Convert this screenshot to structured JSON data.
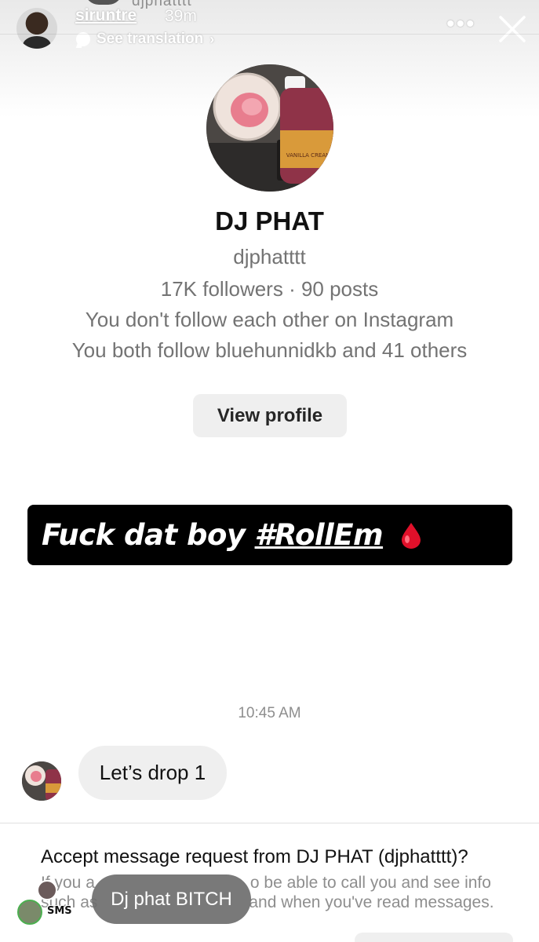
{
  "story_header": {
    "ghost_name": "djphatttt",
    "username": "siruntre",
    "time_ago": "39m",
    "translation_label": "See translation",
    "icons": [
      "speech-bubble-icon",
      "chevron-right-icon",
      "more-icon",
      "close-icon"
    ]
  },
  "profile": {
    "name": "DJ PHAT",
    "handle": "djphatttt",
    "stats": "17K followers · 90 posts",
    "follow_status": "You don't follow each other on Instagram",
    "mutual": "You both follow bluehunnidkb and 41 others",
    "view_profile_label": "View profile",
    "bottle_label": "VANILLA CREAM"
  },
  "story_caption": {
    "text": "Fuck dat boy",
    "hashtag": "#RollEm",
    "emoji": "drop-of-blood-icon"
  },
  "chat": {
    "timestamp": "10:45 AM",
    "message": "Let’s drop 1"
  },
  "message_request": {
    "title": "Accept message request from DJ PHAT (djphatttt)?",
    "line1_left": "If you a",
    "line1_right": "o be able to call you and see info",
    "line2_left": "such as",
    "line2_right": "and when you've read messages."
  },
  "story_reply": {
    "reply_text": "Dj phat BITCH",
    "sticker_text": "SMS"
  },
  "colors": {
    "caption_bg": "#000000",
    "button_bg": "#efefef",
    "muted_text": "#737373",
    "drop_red": "#e0102a"
  }
}
